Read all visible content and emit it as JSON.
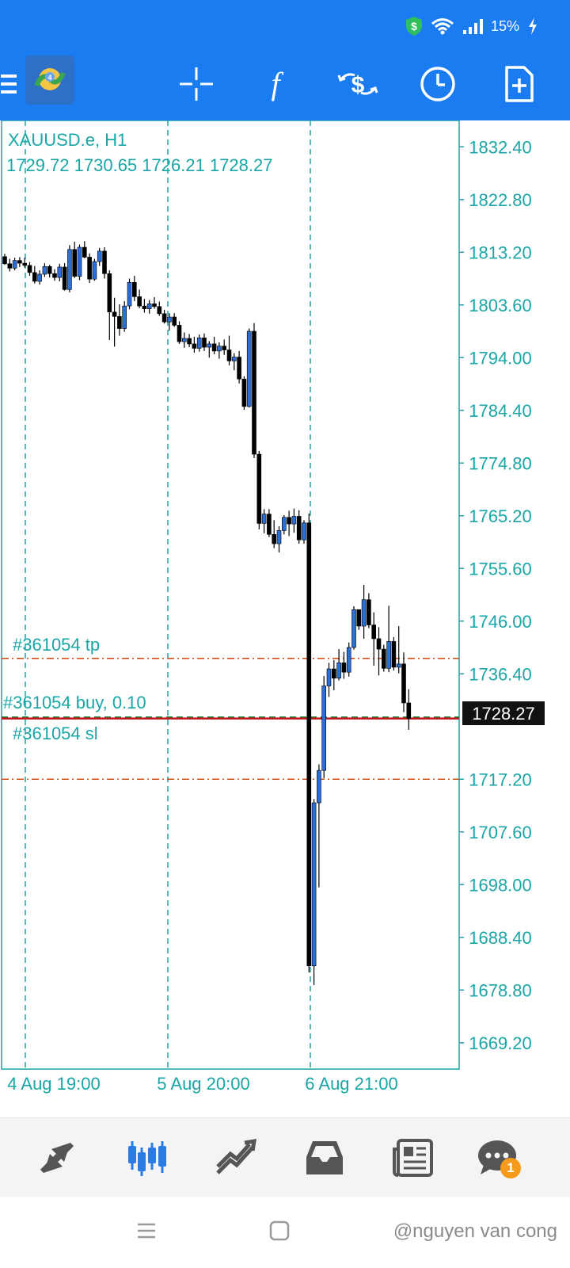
{
  "status_bar": {
    "battery": "15%"
  },
  "toolbar": {
    "icons": [
      "menu-icon",
      "metatrader-logo",
      "crosshair-icon",
      "indicators-icon",
      "trade-icon",
      "timeframe-icon",
      "new-order-icon"
    ]
  },
  "chart": {
    "symbol_label": "XAUUSD.e, H1",
    "ohlc_label": "1729.72 1730.65 1726.21 1728.27",
    "price_labels": [
      "1832.40",
      "1822.80",
      "1813.20",
      "1803.60",
      "1794.00",
      "1784.40",
      "1774.80",
      "1765.20",
      "1755.60",
      "1746.00",
      "1736.40",
      "1717.20",
      "1707.60",
      "1698.00",
      "1688.40",
      "1678.80",
      "1669.20"
    ],
    "time_labels": [
      "4 Aug 19:00",
      "5 Aug 20:00",
      "6 Aug 21:00"
    ],
    "current_price": "1728.27",
    "tp_label": "#361054 tp",
    "buy_label": "#361054 buy, 0.10",
    "sl_label": "#361054 sl",
    "colors": {
      "bull": "#2a6ed8",
      "bear": "#000000",
      "grid": "#1aa6a6",
      "order": "#d4501a"
    }
  },
  "chart_data": {
    "type": "candlestick",
    "ylim": [
      1664.4,
      1837.2
    ],
    "levels": {
      "tp": 1739.2,
      "open": 1728.5,
      "sl": 1717.2,
      "current": 1728.27
    },
    "candles": [
      [
        1812.4,
        1812.9,
        1810.9,
        1811.1
      ],
      [
        1811.1,
        1812.0,
        1809.7,
        1810.3
      ],
      [
        1810.3,
        1812.2,
        1809.9,
        1811.7
      ],
      [
        1811.7,
        1812.3,
        1810.5,
        1811.2
      ],
      [
        1811.2,
        1812.2,
        1810.4,
        1810.8
      ],
      [
        1810.8,
        1811.4,
        1808.9,
        1809.5
      ],
      [
        1809.5,
        1810.7,
        1807.5,
        1807.9
      ],
      [
        1807.9,
        1809.9,
        1807.3,
        1809.2
      ],
      [
        1809.2,
        1811.2,
        1808.7,
        1810.6
      ],
      [
        1810.6,
        1810.9,
        1808.6,
        1809.3
      ],
      [
        1809.3,
        1810.1,
        1808.0,
        1808.6
      ],
      [
        1808.6,
        1811.1,
        1807.9,
        1810.5
      ],
      [
        1810.5,
        1811.2,
        1806.2,
        1806.4
      ],
      [
        1806.4,
        1814.5,
        1805.9,
        1813.7
      ],
      [
        1813.7,
        1815.1,
        1808.5,
        1808.8
      ],
      [
        1808.8,
        1814.6,
        1808.1,
        1814.1
      ],
      [
        1814.1,
        1815.2,
        1812.1,
        1812.3
      ],
      [
        1812.3,
        1813.0,
        1807.6,
        1808.3
      ],
      [
        1808.3,
        1812.0,
        1808.0,
        1811.5
      ],
      [
        1811.5,
        1814.0,
        1810.7,
        1813.4
      ],
      [
        1813.4,
        1814.1,
        1808.4,
        1809.3
      ],
      [
        1809.3,
        1809.9,
        1797.2,
        1802.3
      ],
      [
        1802.3,
        1804.9,
        1796.0,
        1801.5
      ],
      [
        1801.5,
        1803.7,
        1798.0,
        1799.3
      ],
      [
        1799.3,
        1804.3,
        1798.7,
        1803.4
      ],
      [
        1803.4,
        1808.4,
        1802.8,
        1807.7
      ],
      [
        1807.7,
        1808.9,
        1804.3,
        1805.1
      ],
      [
        1805.1,
        1806.4,
        1803.0,
        1803.4
      ],
      [
        1803.4,
        1804.7,
        1802.2,
        1802.9
      ],
      [
        1802.9,
        1804.5,
        1802.0,
        1803.8
      ],
      [
        1803.8,
        1805.0,
        1802.9,
        1803.3
      ],
      [
        1803.3,
        1804.2,
        1801.6,
        1802.0
      ],
      [
        1802.0,
        1802.7,
        1800.2,
        1800.5
      ],
      [
        1800.5,
        1802.1,
        1798.9,
        1801.4
      ],
      [
        1801.4,
        1802.1,
        1799.6,
        1799.9
      ],
      [
        1799.9,
        1800.6,
        1796.5,
        1796.9
      ],
      [
        1796.9,
        1798.6,
        1795.8,
        1797.5
      ],
      [
        1797.5,
        1798.3,
        1795.9,
        1796.5
      ],
      [
        1796.5,
        1797.8,
        1794.9,
        1795.7
      ],
      [
        1795.7,
        1798.2,
        1795.1,
        1797.6
      ],
      [
        1797.6,
        1798.4,
        1795.2,
        1795.9
      ],
      [
        1795.9,
        1797.0,
        1794.0,
        1796.5
      ],
      [
        1796.5,
        1797.8,
        1794.6,
        1795.2
      ],
      [
        1795.2,
        1796.8,
        1793.8,
        1796.1
      ],
      [
        1796.1,
        1797.3,
        1794.5,
        1795.4
      ],
      [
        1795.4,
        1798.0,
        1792.6,
        1793.4
      ],
      [
        1793.4,
        1794.8,
        1791.7,
        1794.1
      ],
      [
        1794.1,
        1795.2,
        1789.3,
        1790.1
      ],
      [
        1790.1,
        1790.6,
        1784.5,
        1785.1
      ],
      [
        1785.1,
        1799.3,
        1784.9,
        1798.8
      ],
      [
        1798.8,
        1800.3,
        1775.7,
        1776.4
      ],
      [
        1776.4,
        1777.0,
        1762.7,
        1763.8
      ],
      [
        1763.8,
        1766.4,
        1762.0,
        1765.5
      ],
      [
        1765.5,
        1766.4,
        1761.3,
        1761.8
      ],
      [
        1761.8,
        1764.4,
        1759.3,
        1760.1
      ],
      [
        1760.1,
        1763.3,
        1758.5,
        1762.5
      ],
      [
        1762.5,
        1765.3,
        1761.8,
        1764.9
      ],
      [
        1764.9,
        1766.1,
        1761.5,
        1763.7
      ],
      [
        1763.7,
        1766.5,
        1762.1,
        1765.1
      ],
      [
        1765.1,
        1766.2,
        1760.1,
        1760.8
      ],
      [
        1760.8,
        1764.4,
        1760.1,
        1763.9
      ],
      [
        1763.9,
        1765.6,
        1682.0,
        1683.2
      ],
      [
        1683.2,
        1713.6,
        1679.7,
        1712.9
      ],
      [
        1712.9,
        1719.9,
        1697.5,
        1718.8
      ],
      [
        1718.8,
        1736.0,
        1717.4,
        1734.2
      ],
      [
        1734.2,
        1738.4,
        1732.2,
        1737.3
      ],
      [
        1737.3,
        1738.9,
        1733.4,
        1735.6
      ],
      [
        1735.6,
        1740.9,
        1735.2,
        1738.4
      ],
      [
        1738.4,
        1740.4,
        1735.5,
        1736.7
      ],
      [
        1736.7,
        1742.1,
        1735.9,
        1741.2
      ],
      [
        1741.2,
        1748.7,
        1740.8,
        1748.1
      ],
      [
        1748.1,
        1747.7,
        1744.4,
        1745.1
      ],
      [
        1745.1,
        1752.6,
        1742.8,
        1749.9
      ],
      [
        1749.9,
        1751.1,
        1744.7,
        1745.3
      ],
      [
        1745.3,
        1747.6,
        1737.9,
        1742.8
      ],
      [
        1742.8,
        1744.9,
        1736.1,
        1740.9
      ],
      [
        1740.9,
        1741.7,
        1736.8,
        1737.4
      ],
      [
        1737.4,
        1748.8,
        1736.7,
        1742.3
      ],
      [
        1742.3,
        1743.1,
        1737.0,
        1737.6
      ],
      [
        1737.6,
        1745.1,
        1736.5,
        1738.2
      ],
      [
        1738.2,
        1740.3,
        1729.4,
        1731.1
      ],
      [
        1731.1,
        1733.6,
        1726.2,
        1728.27
      ]
    ]
  },
  "bottom_nav": {
    "items": [
      "quotes-icon",
      "chart-icon",
      "trade-icon",
      "history-icon",
      "news-icon",
      "messages-icon"
    ],
    "messages_badge": "1"
  },
  "system_nav": {
    "watermark": "@nguyen van cong"
  }
}
